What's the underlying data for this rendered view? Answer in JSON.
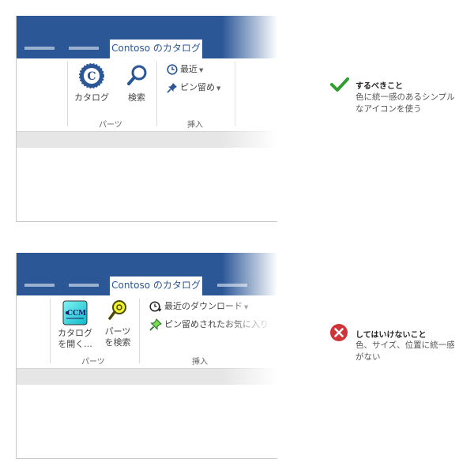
{
  "good": {
    "tab_label": "Contoso のカタログ",
    "catalog_label": "カタログ",
    "search_label": "検索",
    "group1_label": "パーツ",
    "recent_label": "最近",
    "pin_label": "ピン留め",
    "group2_label": "挿入"
  },
  "bad": {
    "tab_label": "Contoso のカタログ",
    "catalog_line1": "カタログ",
    "catalog_line2": "を開く...",
    "catalog_icon_text": "CCM",
    "search_line1": "パーツ",
    "search_line2": "を検索",
    "group1_label": "パーツ",
    "recent_label": "最近のダウンロード",
    "pin_label": "ピン留めされたお気に入り",
    "group2_label": "挿入"
  },
  "notes": {
    "do_title": "するべきこと",
    "do_body": "色に統一感のあるシンプルなアイコンを使う",
    "dont_title": "してはいけないこと",
    "dont_body": "色、サイズ、位置に統一感がない"
  },
  "colors": {
    "titlebar": "#2b5797",
    "accent_blue": "#2b5797",
    "check_green": "#2e9e2e",
    "cross_red": "#d13438"
  },
  "icons": {
    "catalog_good": "catalog-badge-icon",
    "search_good": "magnifier-icon",
    "recent": "clock-icon",
    "pin": "pin-icon",
    "catalog_bad": "ccm-catalog-icon",
    "search_bad": "yellow-magnifier-icon",
    "do_mark": "check-icon",
    "dont_mark": "cross-icon"
  }
}
